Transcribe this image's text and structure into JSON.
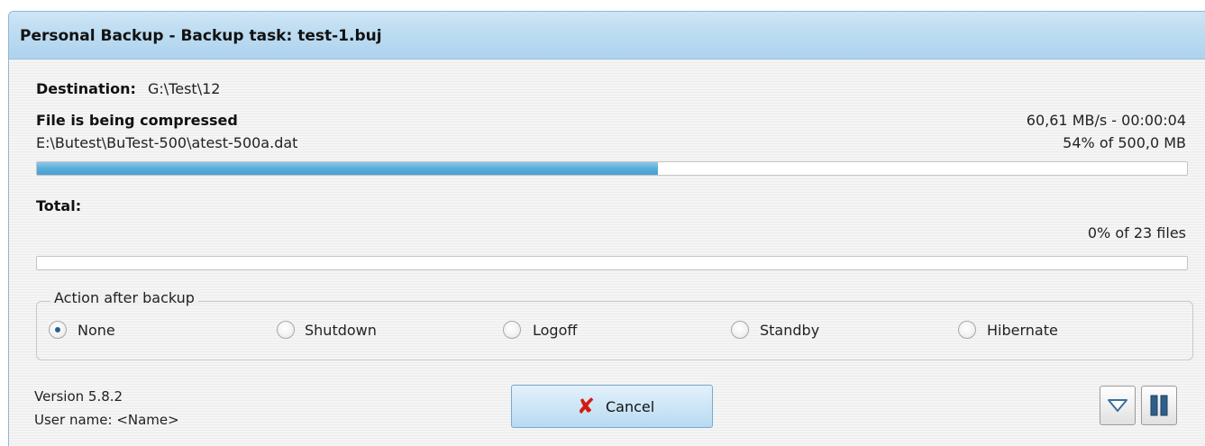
{
  "window": {
    "title": "Personal Backup - Backup task: test-1.buj"
  },
  "destination": {
    "label": "Destination",
    "colon": ":",
    "value": "G:\\Test\\12"
  },
  "current": {
    "status": "File is being compressed",
    "file": "E:\\Butest\\BuTest-500\\atest-500a.dat",
    "speed": "60,61 MB/s - 00:00:04",
    "progress_text": "54% of 500,0 MB",
    "progress_fraction": 0.54
  },
  "total": {
    "label": "Total",
    "colon": ":",
    "progress_text": "0% of 23 files",
    "progress_fraction": 0.0
  },
  "action_after_backup": {
    "label": "Action after backup",
    "options": [
      {
        "label": "None",
        "selected": true
      },
      {
        "label": "Shutdown",
        "selected": false
      },
      {
        "label": "Logoff",
        "selected": false
      },
      {
        "label": "Standby",
        "selected": false
      },
      {
        "label": "Hibernate",
        "selected": false
      }
    ]
  },
  "footer": {
    "version": "Version 5.8.2",
    "user": "User name: <Name>",
    "cancel_label": "Cancel",
    "cancel_icon": "red-x-icon",
    "expand_icon": "triangle-down-icon",
    "pause_icon": "pause-icon"
  },
  "colors": {
    "title_bar": "#bcdcf1",
    "progress_fill": "#5aaedc",
    "cancel_x": "#d51a10",
    "pause": "#2f5f8a"
  }
}
